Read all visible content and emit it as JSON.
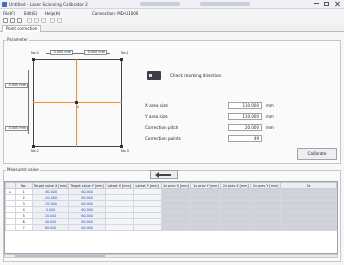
{
  "window": {
    "title": "Untitled - Laser Scanning Calibrator 2"
  },
  "menu": {
    "items": [
      "File(F)",
      "Edit(E)",
      "Help(H)"
    ],
    "connection_label": "Connection: MD-U1000"
  },
  "tabs": [
    "Point correction"
  ],
  "parameter": {
    "group_label": "Parameter",
    "corners": [
      "No.0",
      "No.1",
      "No.2",
      "No.3"
    ],
    "center_label": "0",
    "top_dims": [
      "0.000 mm",
      "0.000 mm"
    ],
    "left_dims": [
      "0.000 mm",
      "0.000 mm"
    ],
    "check_text": "Check marking direction.",
    "fields": [
      {
        "label": "X area size",
        "value": "110.000",
        "unit": "mm"
      },
      {
        "label": "Y area size",
        "value": "110.000",
        "unit": "mm"
      },
      {
        "label": "Correction pitch",
        "value": "20.000",
        "unit": "mm"
      },
      {
        "label": "Correction points",
        "value": "49",
        "unit": ""
      }
    ],
    "calibrate_label": "Calibrate"
  },
  "measured": {
    "group_label": "Measured value",
    "columns": [
      "No.",
      "Target value X [mm]",
      "Target value Y [mm]",
      "Latest X [mm]",
      "Latest Y [mm]",
      "1x prev X [mm]",
      "1x prev Y [mm]",
      "2x prev X [mm]",
      "2x prev Y [mm]",
      "3x"
    ],
    "rows": [
      {
        "marker": "▸",
        "no": "1",
        "tx": "-60.000",
        "ty": "60.000"
      },
      {
        "marker": "",
        "no": "2",
        "tx": "-40.000",
        "ty": "60.000"
      },
      {
        "marker": "",
        "no": "3",
        "tx": "-20.000",
        "ty": "60.000"
      },
      {
        "marker": "",
        "no": "4",
        "tx": "0.000",
        "ty": "60.000"
      },
      {
        "marker": "",
        "no": "5",
        "tx": "20.000",
        "ty": "60.000"
      },
      {
        "marker": "",
        "no": "6",
        "tx": "40.000",
        "ty": "60.000"
      },
      {
        "marker": "",
        "no": "7",
        "tx": "60.000",
        "ty": "60.000"
      }
    ]
  }
}
